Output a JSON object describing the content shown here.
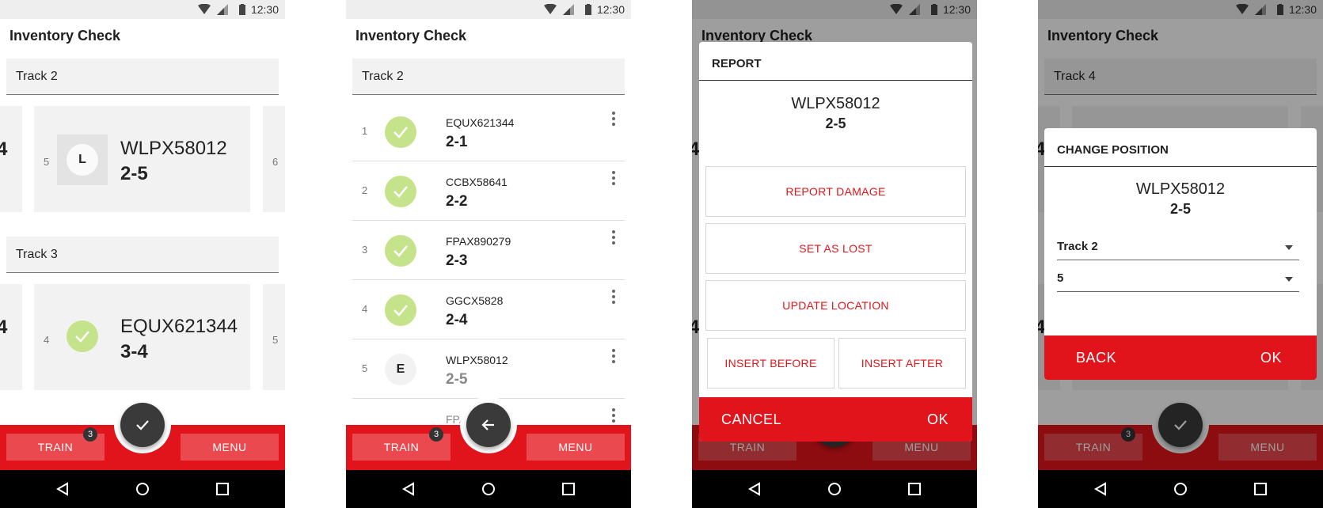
{
  "status": {
    "time": "12:30"
  },
  "app": {
    "title": "Inventory Check"
  },
  "bottom_bar": {
    "train_label": "TRAIN",
    "train_badge": "3",
    "menu_label": "MENU"
  },
  "colors": {
    "accent": "#e2141b",
    "check": "#c5e38b"
  },
  "screen1": {
    "track_a": {
      "header": "Track 2",
      "left_peek_num": "4",
      "right_peek_num": "6",
      "card": {
        "num": "5",
        "icon_letter": "L",
        "id": "WLPX58012",
        "pos": "2-5"
      }
    },
    "track_b": {
      "header": "Track 3",
      "left_peek_num": "4",
      "right_peek_num": "5",
      "card": {
        "num": "4",
        "id": "EQUX621344",
        "pos": "3-4"
      }
    }
  },
  "screen2": {
    "track_header": "Track 2",
    "rows": [
      {
        "num": "1",
        "id": "EQUX621344",
        "pos": "2-1",
        "status": "checked"
      },
      {
        "num": "2",
        "id": "CCBX58641",
        "pos": "2-2",
        "status": "checked"
      },
      {
        "num": "3",
        "id": "FPAX890279",
        "pos": "2-3",
        "status": "checked"
      },
      {
        "num": "4",
        "id": "GGCX5828",
        "pos": "2-4",
        "status": "checked"
      },
      {
        "num": "5",
        "id": "WLPX58012",
        "pos": "2-5",
        "status": "E"
      },
      {
        "num": "",
        "id": "FPA",
        "pos": "",
        "status": "partial"
      }
    ]
  },
  "screen3": {
    "dialog": {
      "title": "REPORT",
      "id": "WLPX58012",
      "pos": "2-5",
      "report_damage": "REPORT DAMAGE",
      "set_as_lost": "SET AS LOST",
      "update_location": "UPDATE LOCATION",
      "insert_before": "INSERT BEFORE",
      "insert_after": "INSERT AFTER",
      "cancel": "CANCEL",
      "ok": "OK"
    },
    "bg_title": "Inventory Check",
    "bg_peek_num": "4"
  },
  "screen4": {
    "bg_title": "Inventory Check",
    "bg_track_header": "Track 4",
    "bg_peek_num": "4",
    "dialog": {
      "title": "CHANGE POSITION",
      "id": "WLPX58012",
      "pos": "2-5",
      "track_value": "Track 2",
      "position_value": "5",
      "back": "BACK",
      "ok": "OK"
    }
  }
}
